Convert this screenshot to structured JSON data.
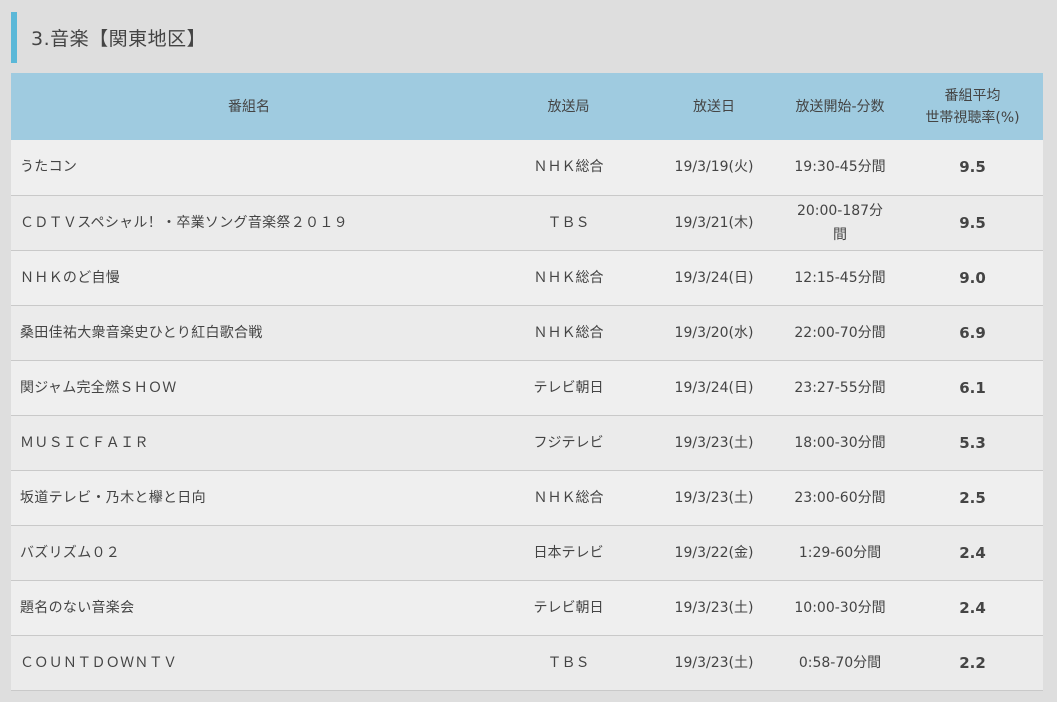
{
  "section": {
    "title": "3.音楽【関東地区】"
  },
  "table": {
    "headers": {
      "name": "番組名",
      "station": "放送局",
      "date": "放送日",
      "time": "放送開始-分数",
      "rating_line1": "番組平均",
      "rating_line2": "世帯視聴率(%)"
    },
    "rows": [
      {
        "name": "うたコン",
        "station": "ＮＨＫ総合",
        "date": "19/3/19(火)",
        "time": "19:30-45分間",
        "rating": "9.5"
      },
      {
        "name": "ＣＤＴＶスペシャル！・卒業ソング音楽祭２０１９",
        "station": "ＴＢＳ",
        "date": "19/3/21(木)",
        "time": "20:00-187分間",
        "rating": "9.5"
      },
      {
        "name": "ＮＨＫのど自慢",
        "station": "ＮＨＫ総合",
        "date": "19/3/24(日)",
        "time": "12:15-45分間",
        "rating": "9.0"
      },
      {
        "name": "桑田佳祐大衆音楽史ひとり紅白歌合戦",
        "station": "ＮＨＫ総合",
        "date": "19/3/20(水)",
        "time": "22:00-70分間",
        "rating": "6.9"
      },
      {
        "name": "関ジャム完全燃ＳＨＯＷ",
        "station": "テレビ朝日",
        "date": "19/3/24(日)",
        "time": "23:27-55分間",
        "rating": "6.1"
      },
      {
        "name": "ＭＵＳＩＣＦＡＩＲ",
        "station": "フジテレビ",
        "date": "19/3/23(土)",
        "time": "18:00-30分間",
        "rating": "5.3"
      },
      {
        "name": "坂道テレビ・乃木と欅と日向",
        "station": "ＮＨＫ総合",
        "date": "19/3/23(土)",
        "time": "23:00-60分間",
        "rating": "2.5"
      },
      {
        "name": "バズリズム０２",
        "station": "日本テレビ",
        "date": "19/3/22(金)",
        "time": "1:29-60分間",
        "rating": "2.4"
      },
      {
        "name": "題名のない音楽会",
        "station": "テレビ朝日",
        "date": "19/3/23(土)",
        "time": "10:00-30分間",
        "rating": "2.4"
      },
      {
        "name": "ＣＯＵＮＴＤＯＷＮＴＶ",
        "station": "ＴＢＳ",
        "date": "19/3/23(土)",
        "time": "0:58-70分間",
        "rating": "2.2"
      }
    ]
  },
  "colors": {
    "accent_bar": "#5bb8d8",
    "header_bg": "#9fcbe0",
    "page_bg": "#dedede"
  }
}
